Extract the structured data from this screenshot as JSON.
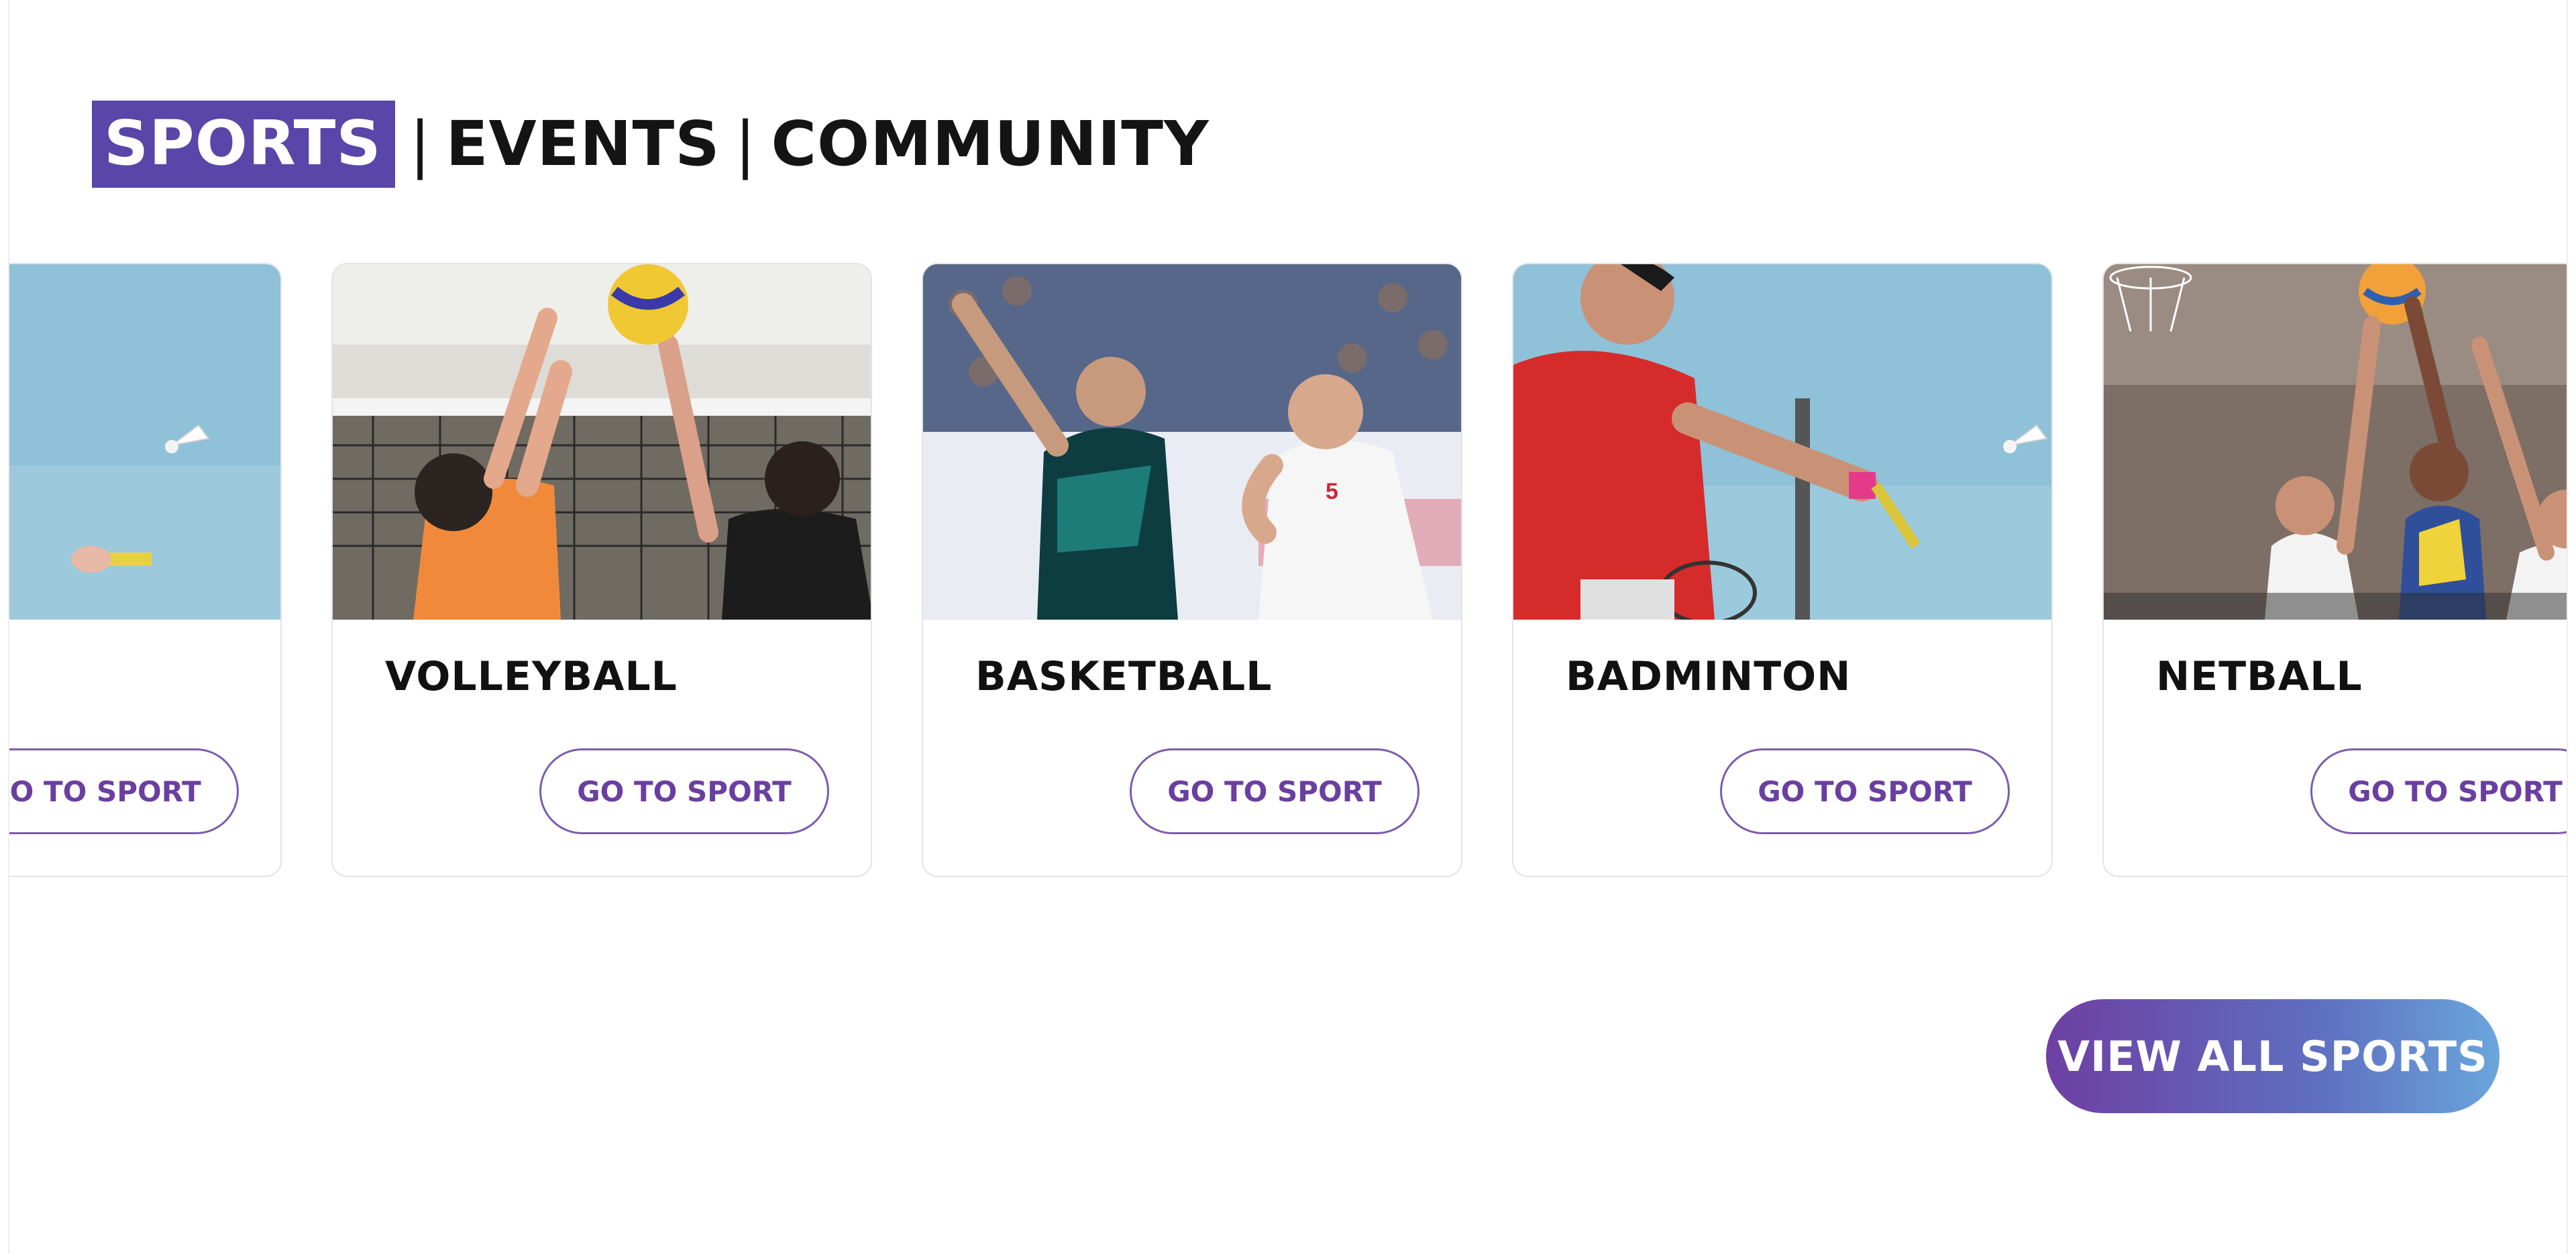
{
  "heading": {
    "tabs": [
      {
        "label": "SPORTS",
        "active": true
      },
      {
        "label": "EVENTS",
        "active": false
      },
      {
        "label": "COMMUNITY",
        "active": false
      }
    ],
    "separator": "|"
  },
  "cards": [
    {
      "title": "",
      "button": "GO TO SPORT",
      "image": "badminton-player-partial"
    },
    {
      "title": "VOLLEYBALL",
      "button": "GO TO SPORT",
      "image": "volleyball-players-at-net"
    },
    {
      "title": "BASKETBALL",
      "button": "GO TO SPORT",
      "image": "basketball-players-in-arena"
    },
    {
      "title": "BADMINTON",
      "button": "GO TO SPORT",
      "image": "badminton-player-smash"
    },
    {
      "title": "NETBALL",
      "button": "GO TO SPORT",
      "image": "netball-players-jumping"
    }
  ],
  "view_all": {
    "label": "VIEW ALL SPORTS"
  },
  "colors": {
    "active_tab": "#5a45a8",
    "button_text": "#6a3fa0",
    "gradient_start": "#6e3fa3",
    "gradient_end": "#6aa6dc"
  }
}
